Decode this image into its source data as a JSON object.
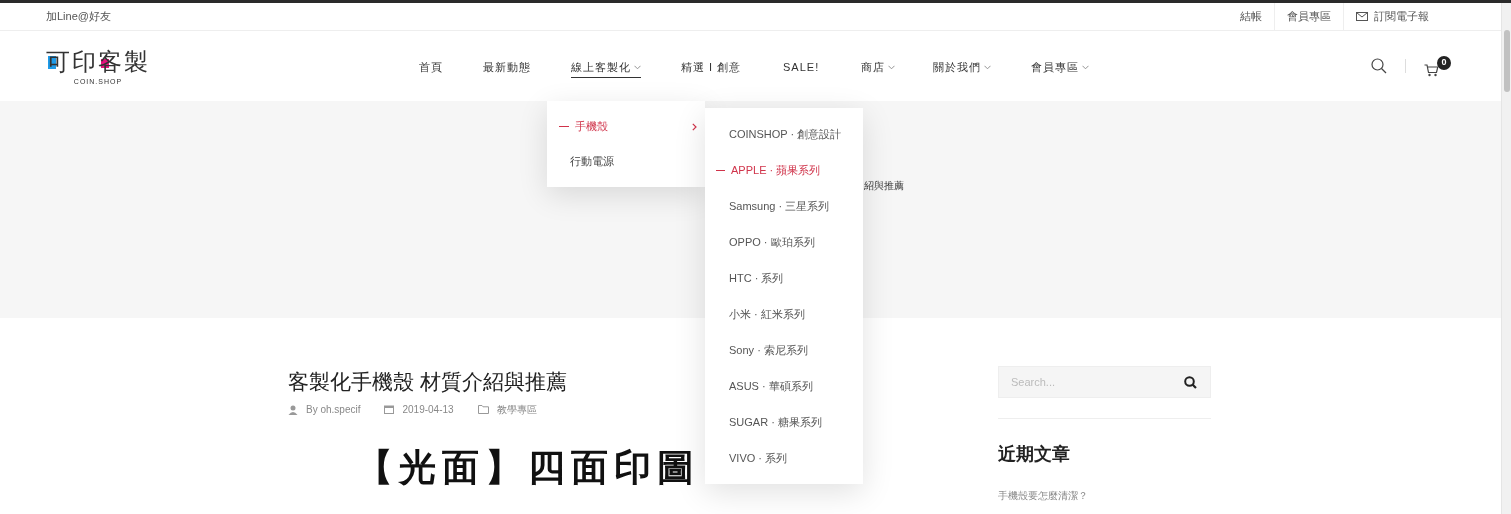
{
  "top_bar": {
    "left_link": "加Line@好友",
    "links": [
      {
        "label": "結帳",
        "kind": "text"
      },
      {
        "label": "會員專區",
        "kind": "text"
      },
      {
        "label": "訂閱電子報",
        "kind": "mail"
      }
    ]
  },
  "logo": {
    "title": "可印客製",
    "subtitle": "COIN.SHOP"
  },
  "nav": [
    {
      "label": "首頁",
      "selected": false,
      "has_dropdown": false
    },
    {
      "label": "最新動態",
      "selected": false,
      "has_dropdown": false
    },
    {
      "label": "線上客製化",
      "selected": true,
      "has_dropdown": true
    },
    {
      "label": "精選 I 創意",
      "selected": false,
      "has_dropdown": false
    },
    {
      "label": "SALE!",
      "selected": false,
      "has_dropdown": false
    },
    {
      "label": "商店",
      "selected": false,
      "has_dropdown": true
    },
    {
      "label": "關於我們",
      "selected": false,
      "has_dropdown": true
    },
    {
      "label": "會員專區",
      "selected": false,
      "has_dropdown": true
    }
  ],
  "cart": {
    "count": "0"
  },
  "dropdown": [
    {
      "label": "手機殼",
      "selected": true,
      "has_submenu": true
    },
    {
      "label": "行動電源",
      "selected": false,
      "has_submenu": false
    }
  ],
  "submenu": [
    {
      "label": "COINSHOP · 創意設計",
      "selected": false
    },
    {
      "label": "APPLE · 蘋果系列",
      "selected": true
    },
    {
      "label": "Samsung · 三星系列",
      "selected": false
    },
    {
      "label": "OPPO · 歐珀系列",
      "selected": false
    },
    {
      "label": "HTC · 系列",
      "selected": false
    },
    {
      "label": "小米 · 紅米系列",
      "selected": false
    },
    {
      "label": "Sony · 索尼系列",
      "selected": false
    },
    {
      "label": "ASUS · 華碩系列",
      "selected": false
    },
    {
      "label": "SUGAR · 糖果系列",
      "selected": false
    },
    {
      "label": "VIVO · 系列",
      "selected": false
    }
  ],
  "breadcrumb_tail": "紹與推薦",
  "article": {
    "title": "客製化手機殼 材質介紹與推薦",
    "author": "By oh.specif",
    "date": "2019-04-13",
    "category": "教學專區",
    "heading": "【光面】四面印圖"
  },
  "sidebar": {
    "search": {
      "placeholder": "Search..."
    },
    "recent_title": "近期文章",
    "recent_posts": [
      "手機殼要怎麼清潔？"
    ]
  }
}
